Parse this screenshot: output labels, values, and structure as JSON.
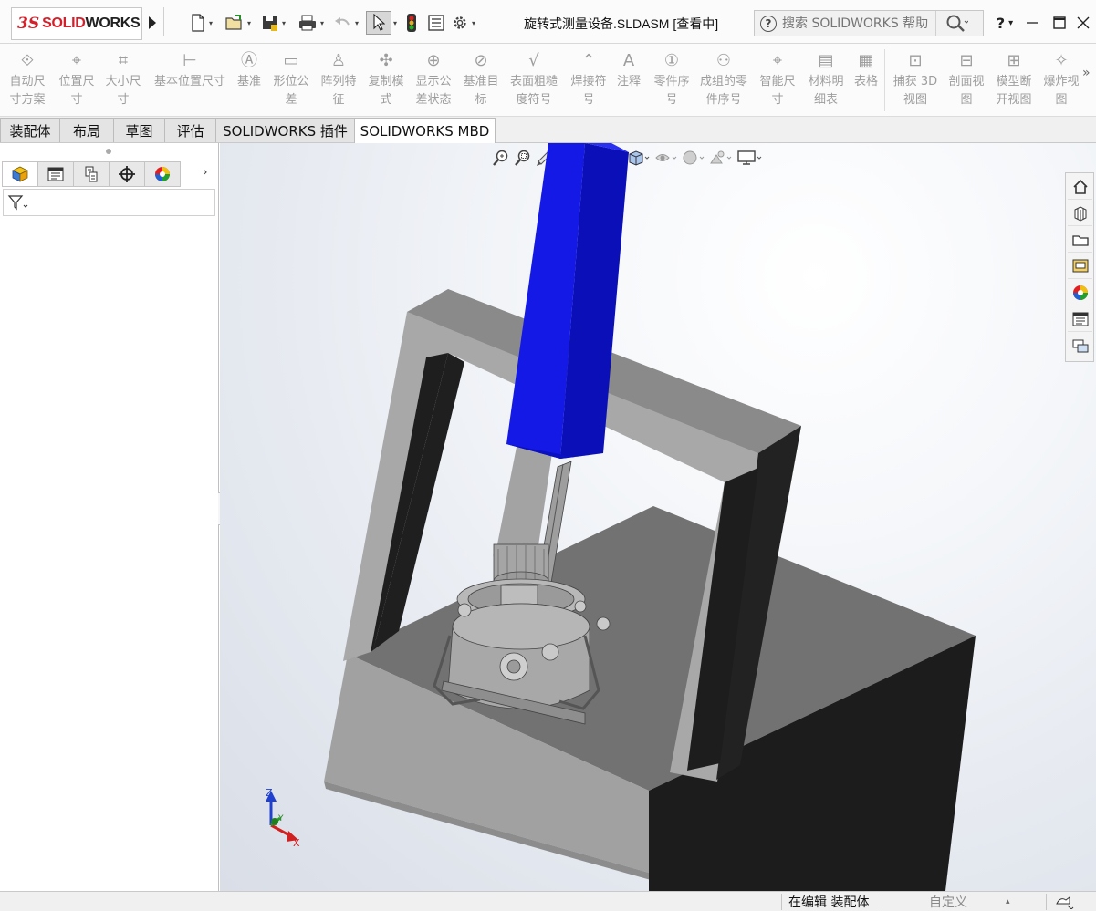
{
  "app": {
    "brand_ds": "3S",
    "brand_solid": "SOLID",
    "brand_works": "WORKS",
    "document_title": "旋转式测量设备.SLDASM [查看中]"
  },
  "search": {
    "placeholder": "搜索 SOLIDWORKS 帮助"
  },
  "title_controls": {
    "help_label": "?",
    "help_dropdown": "▾"
  },
  "ribbon": {
    "items": [
      {
        "label": "自动尺\n寸方案",
        "icon": "auto-dimension-scheme-icon"
      },
      {
        "label": "位置尺\n寸",
        "icon": "location-dimension-icon"
      },
      {
        "label": "大小尺\n寸",
        "icon": "size-dimension-icon"
      },
      {
        "label": "基本位置尺寸",
        "icon": "basic-location-dimension-icon"
      },
      {
        "label": "基准",
        "icon": "datum-icon"
      },
      {
        "label": "形位公\n差",
        "icon": "geometric-tolerance-icon"
      },
      {
        "label": "阵列特\n征",
        "icon": "pattern-feature-icon"
      },
      {
        "label": "复制模\n式",
        "icon": "copy-scheme-icon"
      },
      {
        "label": "显示公\n差状态",
        "icon": "show-tolerance-status-icon"
      },
      {
        "label": "基准目\n标",
        "icon": "datum-target-icon"
      },
      {
        "label": "表面粗糙\n度符号",
        "icon": "surface-finish-icon"
      },
      {
        "label": "焊接符\n号",
        "icon": "weld-symbol-icon"
      },
      {
        "label": "注释",
        "icon": "note-icon"
      },
      {
        "label": "零件序\n号",
        "icon": "balloon-icon"
      },
      {
        "label": "成组的零\n件序号",
        "icon": "stacked-balloon-icon"
      },
      {
        "label": "智能尺\n寸",
        "icon": "smart-dimension-icon"
      },
      {
        "label": "材料明\n细表",
        "icon": "bom-icon"
      },
      {
        "label": "表格",
        "icon": "table-icon"
      },
      {
        "label": "捕获 3D\n视图",
        "icon": "capture-3d-view-icon"
      },
      {
        "label": "剖面视\n图",
        "icon": "section-view-icon"
      },
      {
        "label": "模型断\n开视图",
        "icon": "model-break-view-icon"
      },
      {
        "label": "爆炸视\n图",
        "icon": "exploded-view-icon"
      }
    ],
    "more": "»"
  },
  "tabs": [
    {
      "label": "装配体"
    },
    {
      "label": "布局"
    },
    {
      "label": "草图"
    },
    {
      "label": "评估"
    },
    {
      "label": "SOLIDWORKS 插件"
    },
    {
      "label": "SOLIDWORKS MBD"
    }
  ],
  "left_panel": {
    "tabs": [
      "feature-manager-icon",
      "property-manager-icon",
      "configuration-manager-icon",
      "dimxpert-manager-icon",
      "display-manager-icon"
    ],
    "next": "›"
  },
  "viewport": {
    "triad": {
      "x": "X",
      "y": "Y",
      "z": "Z"
    }
  },
  "task_pane": [
    "home-icon",
    "resources-icon",
    "design-library-icon",
    "file-explorer-icon",
    "view-palette-icon",
    "appearances-icon",
    "custom-properties-icon",
    "forum-icon"
  ],
  "status": {
    "editing": "在编辑 装配体",
    "units": "自定义",
    "units_dropdown": "▴"
  },
  "colors": {
    "model_grey": "#a3a3a3",
    "model_dark": "#1d1d1d",
    "blue_column": "#1419e6",
    "logo_red": "#d4202a"
  }
}
